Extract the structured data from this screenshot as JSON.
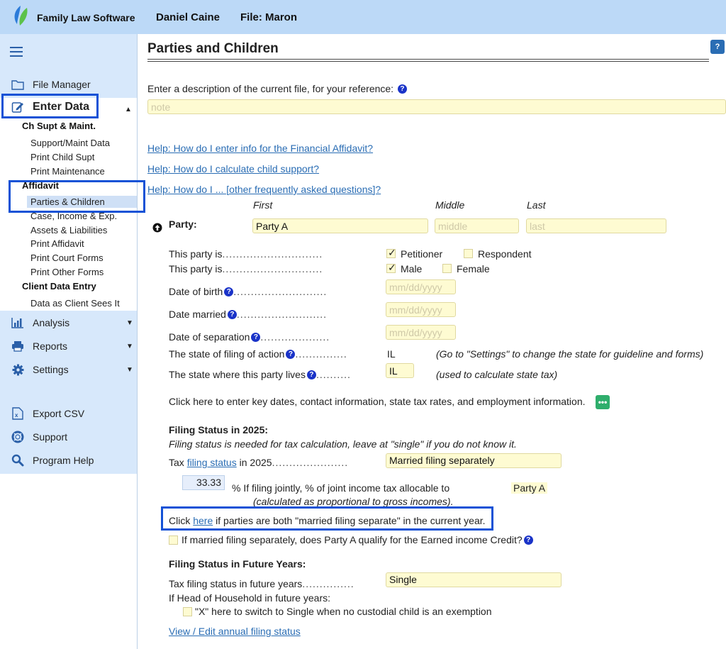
{
  "header": {
    "brand": "Family Law Software",
    "user": "Daniel Caine",
    "file": "File: Maron"
  },
  "sidebar": {
    "file_manager": "File Manager",
    "enter_data": "Enter Data",
    "ch_supt_head": "Ch Supt & Maint.",
    "support_maint": "Support/Maint Data",
    "print_child_supt": "Print Child Supt",
    "print_maintenance": "Print Maintenance",
    "affidavit_head": "Affidavit",
    "parties_children": "Parties & Children",
    "case_income": "Case, Income & Exp.",
    "assets_liabilities": "Assets & Liabilities",
    "print_affidavit": "Print Affidavit",
    "print_court_forms": "Print Court Forms",
    "print_other_forms": "Print Other Forms",
    "client_data_head": "Client Data Entry",
    "data_as_client": "Data as Client Sees It",
    "analysis": "Analysis",
    "reports": "Reports",
    "settings": "Settings",
    "export_csv": "Export CSV",
    "support": "Support",
    "program_help": "Program Help"
  },
  "main": {
    "title": "Parties and Children",
    "help_icon": "?",
    "description_label": "Enter a description of the current file, for your reference:",
    "note_placeholder": "note",
    "help_link_1": "Help: How do I enter info for the Financial Affidavit?",
    "help_link_2": "Help: How do I calculate child support?",
    "help_link_3": "Help: How do I ... [other frequently asked questions]?",
    "col_first": "First",
    "col_middle": "Middle",
    "col_last": "Last",
    "party_label": "Party:",
    "first_value": "Party A",
    "middle_placeholder": "middle",
    "last_placeholder": "last",
    "this_party_is_1": "This party is",
    "petitioner": "Petitioner",
    "respondent": "Respondent",
    "this_party_is_2": "This party is",
    "male": "Male",
    "female": "Female",
    "dob_label": "Date of birth",
    "date_placeholder": "mm/dd/yyyy",
    "married_label": "Date married",
    "separation_label": "Date of separation",
    "state_filing_label": "The state of filing of action",
    "state_filing_value": "IL",
    "state_filing_note": "(Go to \"Settings\" to change the state for guideline and forms)",
    "state_lives_label": "The state where this party lives",
    "state_lives_value": "IL",
    "state_lives_note": "(used to calculate state tax)",
    "key_dates_text": "Click here to enter key dates, contact information, state tax rates, and employment information.",
    "key_dates_btn": "•••",
    "filing_head": "Filing Status in 2025:",
    "filing_note": "Filing status is needed for tax calculation, leave at \"single\" if you do not know it.",
    "tax_prefix": "Tax",
    "tax_link": "filing status",
    "tax_suffix": "in 2025",
    "filing_value": "Married filing separately",
    "pct_value": "33.33",
    "pct_text": "% If filing jointly, % of joint income tax allocable to",
    "pct_party": "Party A",
    "pct_note": "(calculated as proportional to gross incomes).",
    "click_prefix": "Click",
    "click_link": "here",
    "click_suffix": "if parties are both \"married filing separate\" in the current year.",
    "eic_text": "If married filing separately, does Party A qualify for the Earned income Credit?",
    "future_head": "Filing Status in Future Years:",
    "future_label": "Tax filing status in future years",
    "future_value": "Single",
    "hoh_label": "If Head of Household in future years:",
    "switch_text": "\"X\" here to switch to Single when no custodial child is an exemption",
    "view_edit_link": "View / Edit annual filing status"
  }
}
